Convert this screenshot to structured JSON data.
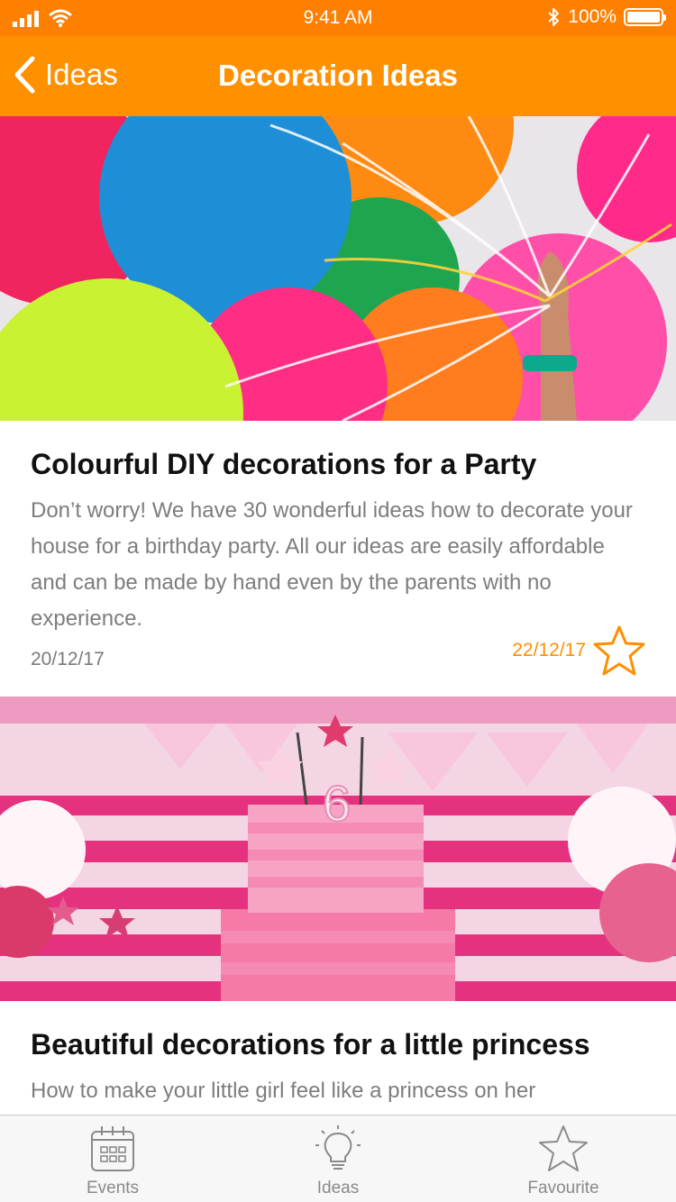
{
  "status_bar": {
    "time": "9:41 AM",
    "battery": "100%",
    "icons": [
      "signal-icon",
      "wifi-icon",
      "bluetooth-icon",
      "battery-icon"
    ]
  },
  "nav": {
    "back_label": "Ideas",
    "title": "Decoration Ideas",
    "background": "#ff9000"
  },
  "cards": [
    {
      "image": "balloons-photo",
      "title": "Colourful DIY decorations for a Party",
      "text": "Don’t worry! We have 30 wonderful ideas how to decorate your house for a birthday party. All our ideas are easily affordable and can be made by hand even by the parents with no experience.",
      "date": "20/12/17",
      "favourite_date": "22/12/17",
      "favourite_icon": "star-outline-icon"
    },
    {
      "image": "princess-cake-photo",
      "title": "Beautiful decorations for a little princess",
      "text": "How to make your little girl feel like a princess on her"
    }
  ],
  "tabs": [
    {
      "label": "Events",
      "icon": "calendar-icon"
    },
    {
      "label": "Ideas",
      "icon": "lightbulb-icon"
    },
    {
      "label": "Favourite",
      "icon": "star-outline-icon"
    }
  ],
  "colors": {
    "accent": "#ff9000",
    "status_bar": "#ff7f00",
    "title_text": "#111111",
    "body_text": "#7d7d7d"
  }
}
